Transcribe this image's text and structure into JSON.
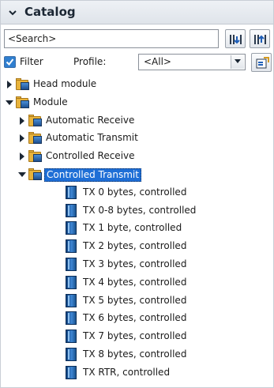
{
  "header": {
    "title": "Catalog"
  },
  "search": {
    "placeholder": "<Search>",
    "value": "<Search>"
  },
  "filter": {
    "checkbox_label": "Filter",
    "checked": true,
    "profile_label": "Profile:",
    "profile_value": "<All>"
  },
  "tree": {
    "items": [
      {
        "label": "Head module",
        "level": 0,
        "expanded": false,
        "type": "folder"
      },
      {
        "label": "Module",
        "level": 0,
        "expanded": true,
        "type": "folder"
      },
      {
        "label": "Automatic Receive",
        "level": 1,
        "expanded": false,
        "type": "folder"
      },
      {
        "label": "Automatic Transmit",
        "level": 1,
        "expanded": false,
        "type": "folder"
      },
      {
        "label": "Controlled Receive",
        "level": 1,
        "expanded": false,
        "type": "folder"
      },
      {
        "label": "Controlled Transmit",
        "level": 1,
        "expanded": true,
        "type": "folder",
        "selected": true
      },
      {
        "label": "TX 0 bytes, controlled",
        "level": 2,
        "type": "module"
      },
      {
        "label": "TX 0-8 bytes, controlled",
        "level": 2,
        "type": "module"
      },
      {
        "label": "TX 1 byte, controlled",
        "level": 2,
        "type": "module"
      },
      {
        "label": "TX 2 bytes, controlled",
        "level": 2,
        "type": "module"
      },
      {
        "label": "TX 3 bytes, controlled",
        "level": 2,
        "type": "module"
      },
      {
        "label": "TX 4 bytes, controlled",
        "level": 2,
        "type": "module"
      },
      {
        "label": "TX 5 bytes, controlled",
        "level": 2,
        "type": "module"
      },
      {
        "label": "TX 6 bytes, controlled",
        "level": 2,
        "type": "module"
      },
      {
        "label": "TX 7 bytes, controlled",
        "level": 2,
        "type": "module"
      },
      {
        "label": "TX 8 bytes, controlled",
        "level": 2,
        "type": "module"
      },
      {
        "label": "TX RTR, controlled",
        "level": 2,
        "type": "module"
      }
    ]
  },
  "colors": {
    "selection": "#1f6fd6",
    "folder": "#e7b33c",
    "module": "#1d4f8f"
  }
}
